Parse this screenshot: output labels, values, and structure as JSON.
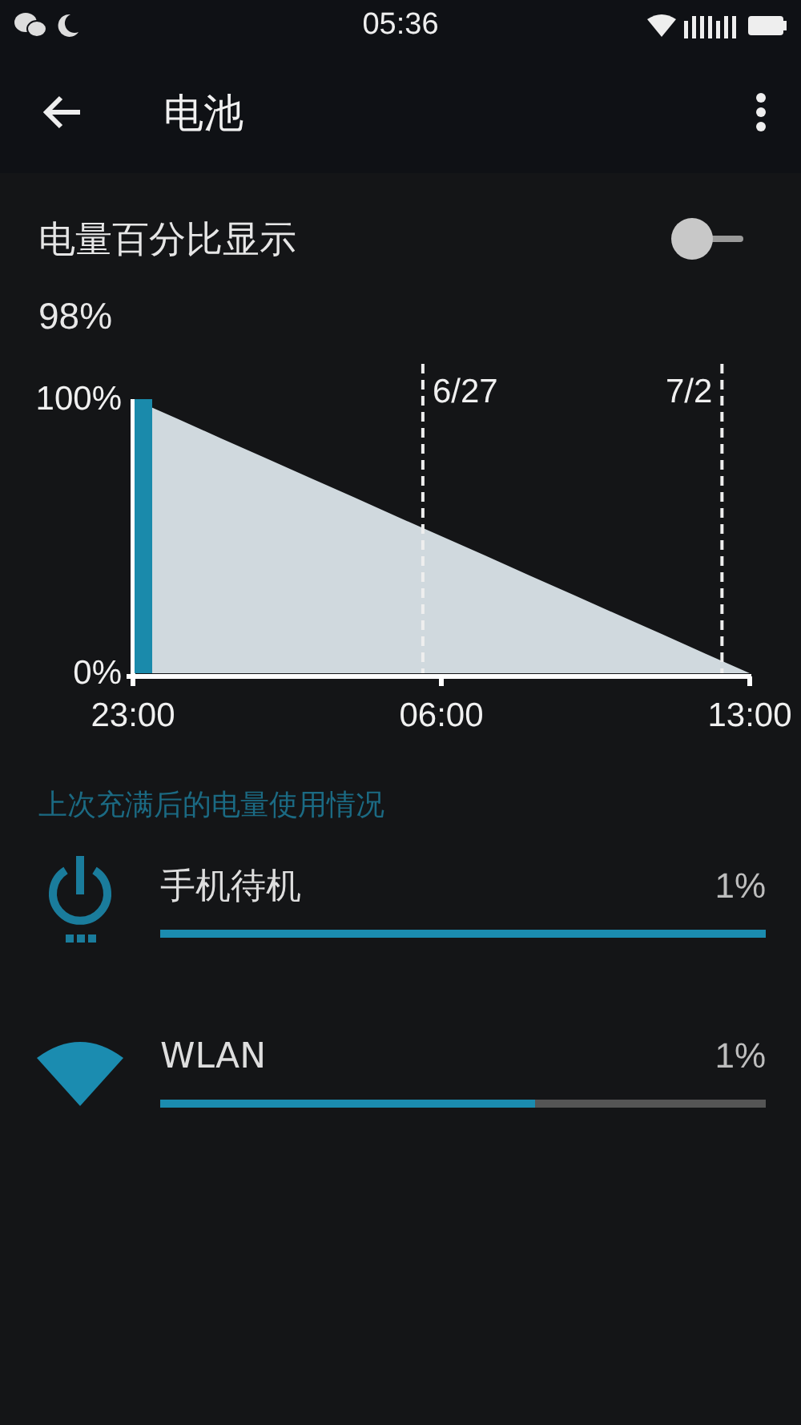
{
  "status_bar": {
    "time": "05:36"
  },
  "app_bar": {
    "title": "电池"
  },
  "percent_setting": {
    "label": "电量百分比显示",
    "on": false
  },
  "battery_level": "98%",
  "chart": {
    "chart_data": {
      "type": "area",
      "categories": [
        "23:00",
        null,
        null,
        null,
        null,
        null,
        null,
        "06:00",
        null,
        null,
        null,
        null,
        null,
        null,
        "13:00"
      ],
      "series": [
        {
          "color": "#d0d9de",
          "values": [
            100,
            92.9,
            85.7,
            78.6,
            71.4,
            64.3,
            57.1,
            50,
            42.9,
            35.7,
            28.6,
            21.4,
            14.3,
            7.1,
            0
          ]
        }
      ],
      "ylim": [
        0,
        100
      ],
      "yticks": [
        {
          "value": 0,
          "label": "0%"
        },
        {
          "value": 100,
          "label": "100%"
        }
      ]
    },
    "date_markers": [
      {
        "label": "6/27"
      },
      {
        "label": "7/2"
      }
    ]
  },
  "usage": {
    "heading": "上次充满后的电量使用情况",
    "items": [
      {
        "kind": "power",
        "name": "手机待机",
        "percent": "1%",
        "level": 1.0
      },
      {
        "kind": "wifi",
        "name": "WLAN",
        "percent": "1%",
        "level": 0.62
      }
    ]
  }
}
